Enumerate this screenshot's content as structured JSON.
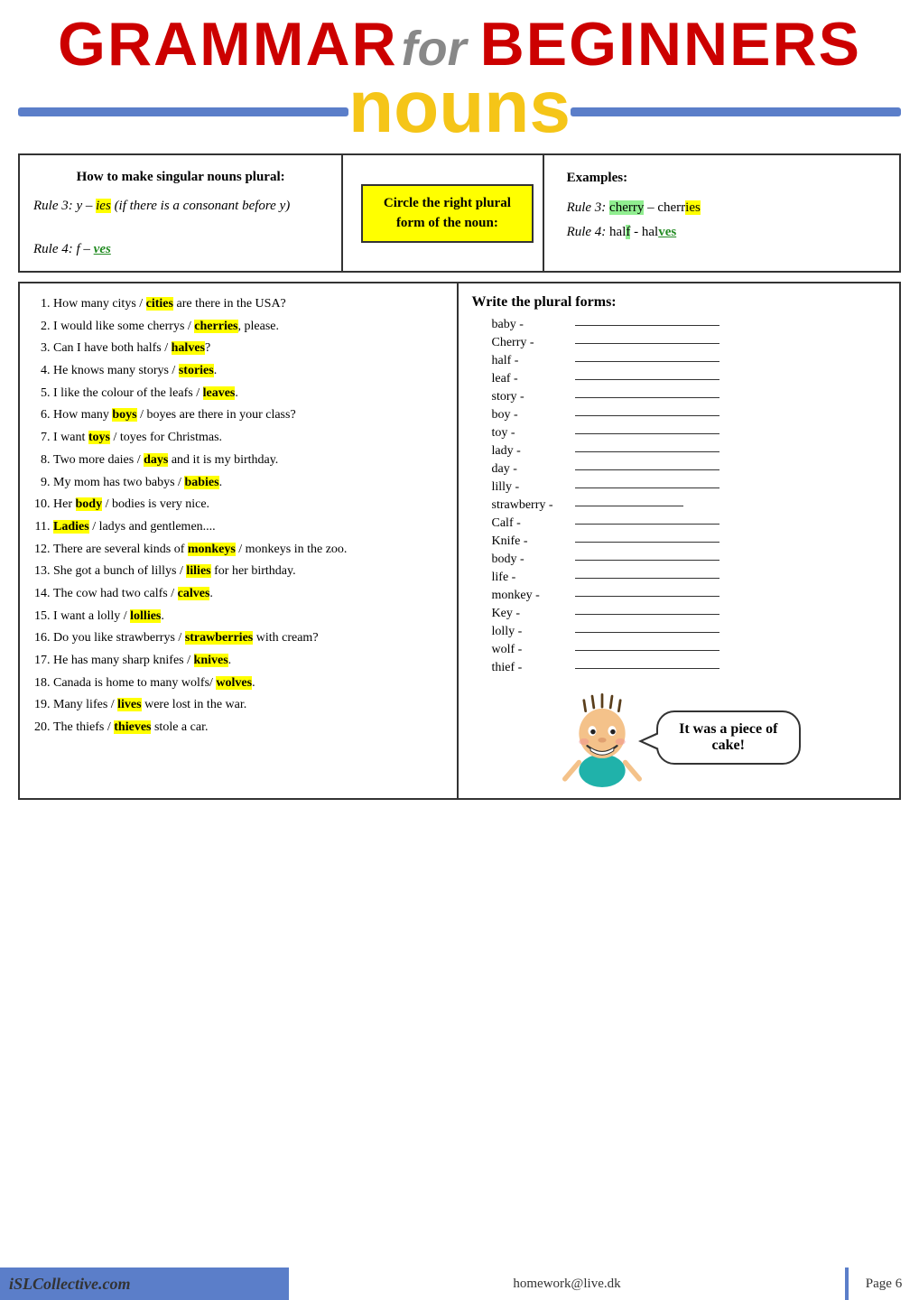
{
  "header": {
    "title_part1": "GRAMMAR for BEGINNERS",
    "subtitle": "nouns",
    "grammar": "GRAMMAR",
    "for": "for",
    "beginners": "BEGINNERS"
  },
  "rules_box": {
    "heading": "How to make singular nouns plural:",
    "rule3": "Rule 3: y – ies (if there is a consonant before y)",
    "rule4": "Rule 4: f – ves"
  },
  "circle_box": {
    "text": "Circle the right plural form of the noun:"
  },
  "examples_box": {
    "heading": "Examples:",
    "rule3": "Rule 3: cherry – cherries",
    "rule4": "Rule 4: half - halves"
  },
  "exercise": {
    "heading": "Circle the right plural form:",
    "items": [
      "How many citys / cities are there in the USA?",
      "I would like some cherrys / cherries, please.",
      "Can I have both halfs / halves?",
      "He knows many storys / stories.",
      "I like the colour of the leafs / leaves.",
      "How many boys / boyes are there in your class?",
      "I want toys / toyes for Christmas.",
      "Two more daies / days and it is my birthday.",
      "My mom has two babys / babies.",
      "Her body / bodies is very nice.",
      "Ladies / ladys and gentlemen....",
      "There are several kinds of monkeys / monkeys in the zoo.",
      "She got a bunch of lillys / lilies for her birthday.",
      "The cow had two calfs / calves.",
      "I want a lolly / lollies.",
      "Do you like strawberrys / strawberries with cream?",
      "He has many sharp knifes / knives.",
      "Canada is home to many wolfs/ wolves.",
      "Many lifes / lives were lost in the war.",
      "The thiefs / thieves stole a car."
    ]
  },
  "plural_forms": {
    "heading": "Write the plural forms:",
    "items": [
      "baby -",
      "Cherry -",
      "half -",
      "leaf -",
      "story -",
      "boy -",
      "toy -",
      "lady -",
      "day -",
      "lilly -",
      "strawberry -",
      "Calf -",
      "Knife -",
      "body -",
      "life -",
      "monkey -",
      "Key -",
      "lolly -",
      "wolf -",
      "thief -"
    ]
  },
  "cake_text": "It was a piece of cake!",
  "footer": {
    "branding": "iSLCollective.com",
    "email": "homework@live.dk",
    "page": "Page 6"
  }
}
